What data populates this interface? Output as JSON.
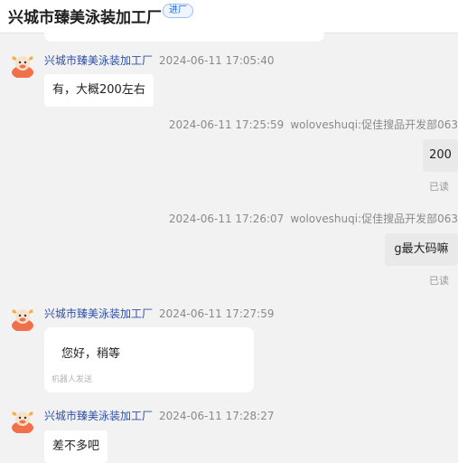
{
  "header": {
    "shop_name": "兴城市臻美泳装加工厂",
    "badge": "进厂"
  },
  "messages": [
    {
      "sender": "兴城市臻美泳装加工厂",
      "time": "2024-06-11 17:05:40",
      "text": "有，大概200左右"
    },
    {
      "time": "2024-06-11 17:25:59",
      "agent": "woloveshuqi:促佳搜品开发部063",
      "text": "200",
      "status": "已读"
    },
    {
      "time": "2024-06-11 17:26:07",
      "agent": "woloveshuqi:促佳搜品开发部063",
      "text": "g最大码嘛",
      "status": "已读"
    },
    {
      "sender": "兴城市臻美泳装加工厂",
      "time": "2024-06-11 17:27:59",
      "text": "您好，稍等",
      "note": "机器人发送"
    },
    {
      "sender": "兴城市臻美泳装加工厂",
      "time": "2024-06-11 17:28:27",
      "text": "差不多吧"
    }
  ],
  "colors": {
    "background": "#f2f2f2",
    "sender_name": "#2d4fa8",
    "avatar_body": "#f0704a",
    "avatar_horn": "#f5b04b"
  },
  "icons": {
    "avatar": "cow-mascot-icon"
  }
}
